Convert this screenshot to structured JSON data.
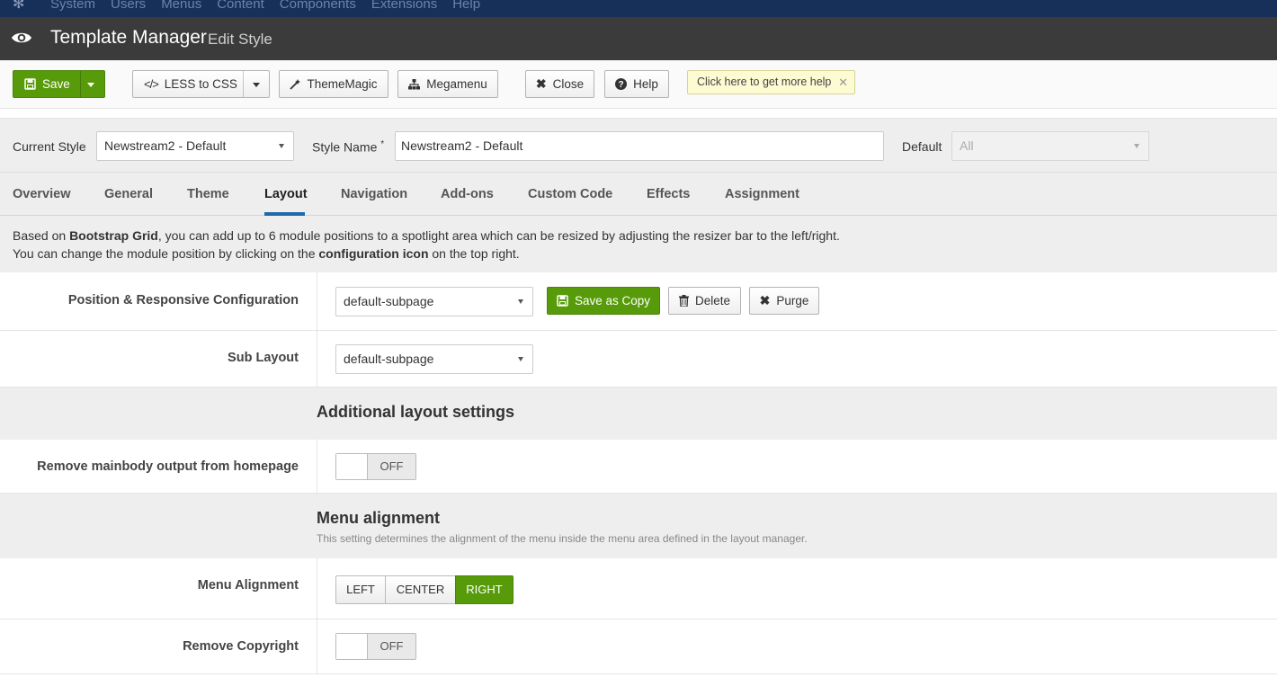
{
  "topnav": {
    "items": [
      "System",
      "Users",
      "Menus",
      "Content",
      "Components",
      "Extensions",
      "Help"
    ]
  },
  "header": {
    "title": "Template Manager",
    "subtitle": "Edit Style"
  },
  "toolbar": {
    "save": "Save",
    "less_to_css": "LESS to CSS",
    "thememagic": "ThemeMagic",
    "megamenu": "Megamenu",
    "close": "Close",
    "help": "Help",
    "tip": "Click here to get more help"
  },
  "style_row": {
    "current_style_label": "Current Style",
    "current_style_value": "Newstream2 - Default",
    "style_name_label": "Style Name",
    "style_name_required": "*",
    "style_name_value": "Newstream2 - Default",
    "default_label": "Default",
    "default_value": "All"
  },
  "tabs": [
    "Overview",
    "General",
    "Theme",
    "Layout",
    "Navigation",
    "Add-ons",
    "Custom Code",
    "Effects",
    "Assignment"
  ],
  "active_tab": "Layout",
  "info": {
    "line1_pre": "Based on ",
    "line1_bold": "Bootstrap Grid",
    "line1_post": ", you can add up to 6 module positions to a spotlight area which can be resized by adjusting the resizer bar to the left/right.",
    "line2_pre": "You can change the module position by clicking on the ",
    "line2_bold": "configuration icon",
    "line2_post": " on the top right."
  },
  "position_config": {
    "label": "Position & Responsive Configuration",
    "value": "default-subpage",
    "save_as_copy": "Save as Copy",
    "delete": "Delete",
    "purge": "Purge"
  },
  "sub_layout": {
    "label": "Sub Layout",
    "value": "default-subpage"
  },
  "additional": {
    "heading": "Additional layout settings",
    "remove_mainbody_label": "Remove mainbody output from homepage",
    "remove_mainbody_state": "OFF"
  },
  "menu_alignment_section": {
    "heading": "Menu alignment",
    "description": "This setting determines the alignment of the menu inside the menu area defined in the layout manager.",
    "label": "Menu Alignment",
    "options": [
      "LEFT",
      "CENTER",
      "RIGHT"
    ],
    "selected": "RIGHT"
  },
  "remove_copyright": {
    "label": "Remove Copyright",
    "state": "OFF"
  },
  "colors": {
    "primary_green": "#579b0a",
    "header_dark": "#3b3b3b",
    "topnav_blue": "#17305a",
    "tab_underline": "#1f6aa8"
  }
}
